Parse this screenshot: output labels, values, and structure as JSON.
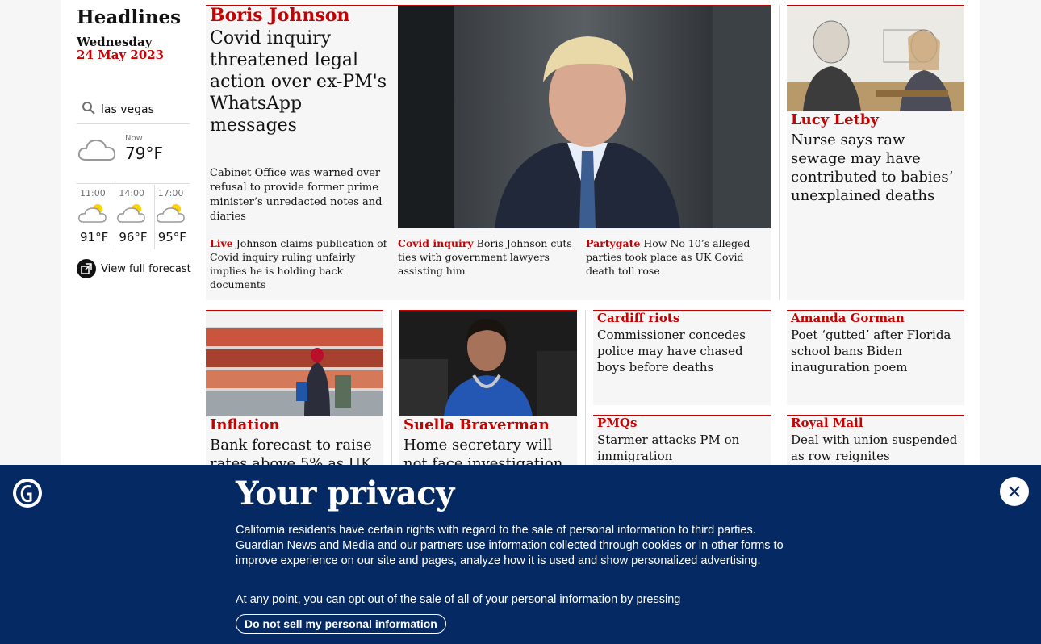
{
  "section": {
    "title": "Headlines",
    "day": "Wednesday",
    "date": "24 May 2023"
  },
  "weather": {
    "location": "las vegas",
    "now_label": "Now",
    "now_temp": "79°F",
    "forecast": [
      {
        "time": "11:00",
        "temp": "91°F",
        "icon": "sun-cloud-icon"
      },
      {
        "time": "14:00",
        "temp": "96°F",
        "icon": "sun-cloud-icon"
      },
      {
        "time": "17:00",
        "temp": "95°F",
        "icon": "sun-cloud-icon"
      }
    ],
    "full_forecast_label": "View full forecast"
  },
  "top_story": {
    "kicker": "Boris Johnson",
    "headline": "Covid inquiry threatened legal action over ex-PM's WhatsApp messages",
    "standfirst": "Cabinet Office was warned over refusal to provide former prime minister’s unredacted notes and diaries",
    "sublinks": [
      {
        "kicker": "Live",
        "text": "Johnson claims publication of Covid inquiry ruling unfairly implies he is holding back documents"
      },
      {
        "kicker": "Covid inquiry",
        "text": "Boris Johnson cuts ties with government lawyers assisting him"
      },
      {
        "kicker": "Partygate",
        "text": "How No 10’s alleged parties took place as UK Covid death toll rose"
      }
    ]
  },
  "right_story": {
    "kicker": "Lucy Letby",
    "headline": "Nurse says raw sewage may have contributed to babies’ unexplained deaths"
  },
  "row2": [
    {
      "kicker": "Inflation",
      "headline": "Bank forecast to raise rates above 5% as UK"
    },
    {
      "kicker": "Suella Braverman",
      "headline": "Home secretary will not face investigation"
    }
  ],
  "small_stories": [
    {
      "kicker": "Cardiff riots",
      "headline": "Commissioner concedes police may have chased boys before deaths"
    },
    {
      "kicker": "Amanda Gorman",
      "headline": "Poet ‘gutted’ after Florida school bans Biden inauguration poem"
    },
    {
      "kicker": "PMQs",
      "headline": "Starmer attacks PM on immigration"
    },
    {
      "kicker": "Royal Mail",
      "headline": "Deal with union suspended as row reignites"
    }
  ],
  "privacy": {
    "title": "Your privacy",
    "text": "California residents have certain rights with regard to the sale of personal information to third parties. Guardian News and Media and our partners use information collected through cookies or in other forms to improve experience on our site and pages, analyze how it is used and show personalized advertising.",
    "text2": "At any point, you can opt out of the sale of all of your personal information by pressing",
    "button": "Do not sell my personal information"
  },
  "colors": {
    "accent": "#c70000",
    "banner": "#052962"
  }
}
